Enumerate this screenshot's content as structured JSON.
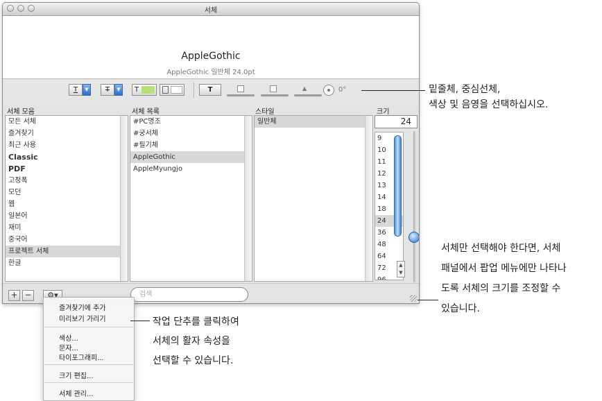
{
  "window": {
    "title": "서체"
  },
  "preview": {
    "font_name": "AppleGothic",
    "info": "AppleGothic  일반체 24.0pt"
  },
  "toolbar": {
    "rotation": "0°"
  },
  "columns": {
    "collections": "서체 모음",
    "family": "서체 목록",
    "typeface": "스타일",
    "size": "크기"
  },
  "collections": [
    {
      "label": "모든 서체"
    },
    {
      "label": "즐겨찾기"
    },
    {
      "label": "최근 사용"
    },
    {
      "label": "Classic"
    },
    {
      "label": "PDF"
    },
    {
      "label": "고정폭"
    },
    {
      "label": "모던"
    },
    {
      "label": "웹"
    },
    {
      "label": "일본어"
    },
    {
      "label": "재미"
    },
    {
      "label": "중국어"
    },
    {
      "label": "프로젝트 서체"
    },
    {
      "label": "한글"
    }
  ],
  "families": [
    {
      "label": "#PC명조"
    },
    {
      "label": "#궁서체"
    },
    {
      "label": "#필기체"
    },
    {
      "label": "AppleGothic"
    },
    {
      "label": "AppleMyungjo"
    }
  ],
  "typefaces": [
    {
      "label": "일반체"
    }
  ],
  "size": {
    "value": "24",
    "list": [
      "9",
      "10",
      "11",
      "12",
      "13",
      "14",
      "18",
      "24",
      "36",
      "48",
      "64",
      "72",
      "96"
    ],
    "level_fraction": 0.72
  },
  "bottom": {
    "add": "+",
    "remove": "−",
    "action": "⚙▾",
    "search_placeholder": "검색"
  },
  "action_menu": {
    "items": [
      "즐겨찾기에 추가",
      "미리보기 가리기",
      "색상...",
      "문자...",
      "타이포그래피...",
      "크기 편집...",
      "서체 관리..."
    ]
  },
  "callouts": {
    "top": [
      "밑줄체, 중심선체,",
      "색상 및 음영을 선택하십시오."
    ],
    "right": [
      "서체만 선택해야 한다면, 서체",
      "패널에서 팝업 메뉴에만 나타나",
      "도록 서체의 크기를 조정할 수",
      "있습니다."
    ],
    "bottom": [
      "작업 단추를 클릭하여",
      "서체의 활자 속성을",
      "선택할 수 있습니다."
    ]
  },
  "colors": {
    "selection": "#d8d8d8",
    "aqua": "#2f78d0",
    "swatch": "#b8e07a"
  }
}
